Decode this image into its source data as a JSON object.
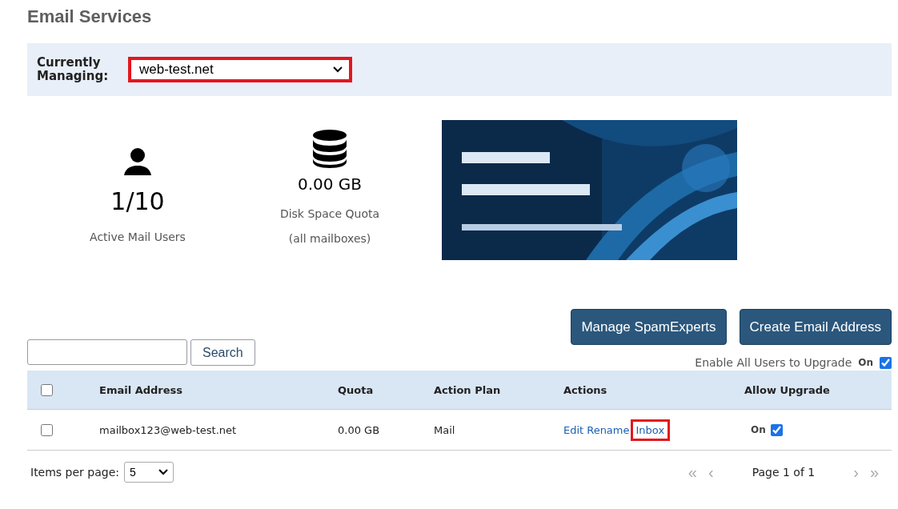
{
  "page_title": "Email Services",
  "managing": {
    "label": "Currently Managing:",
    "value": "web-test.net",
    "highlighted": true
  },
  "stats": [
    {
      "kind": "users",
      "value": "1/10",
      "labels": [
        "Active Mail Users"
      ]
    },
    {
      "kind": "disk",
      "value": "0.00 GB",
      "labels": [
        "Disk Space Quota",
        "(all mailboxes)"
      ]
    }
  ],
  "banner": {
    "kind": "picture"
  },
  "buttons": [
    "Manage SpamExperts",
    "Create Email Address"
  ],
  "search": {
    "button": "Search"
  },
  "enable_all": {
    "label": "Enable All Users to Upgrade",
    "state_text": "On",
    "checked": true
  },
  "table": {
    "select_all_checked": false,
    "columns": [
      "Email Address",
      "Quota",
      "Action Plan",
      "Actions",
      "Allow Upgrade"
    ],
    "rows": [
      {
        "checked": false,
        "email": "mailbox123@web-test.net",
        "quota": "0.00 GB",
        "plan": "Mail",
        "actions": [
          {
            "label": "Edit",
            "highlighted": false
          },
          {
            "label": "Rename",
            "highlighted": false
          },
          {
            "label": "Inbox",
            "highlighted": true
          }
        ],
        "upgrade_text": "On",
        "upgrade_checked": true
      }
    ]
  },
  "footer": {
    "items_label": "Items per page:",
    "items_value": "5",
    "first": "«",
    "prev": "‹",
    "page_text": "Page 1 of 1",
    "next": "›",
    "last": "»",
    "nav_disabled": true
  }
}
